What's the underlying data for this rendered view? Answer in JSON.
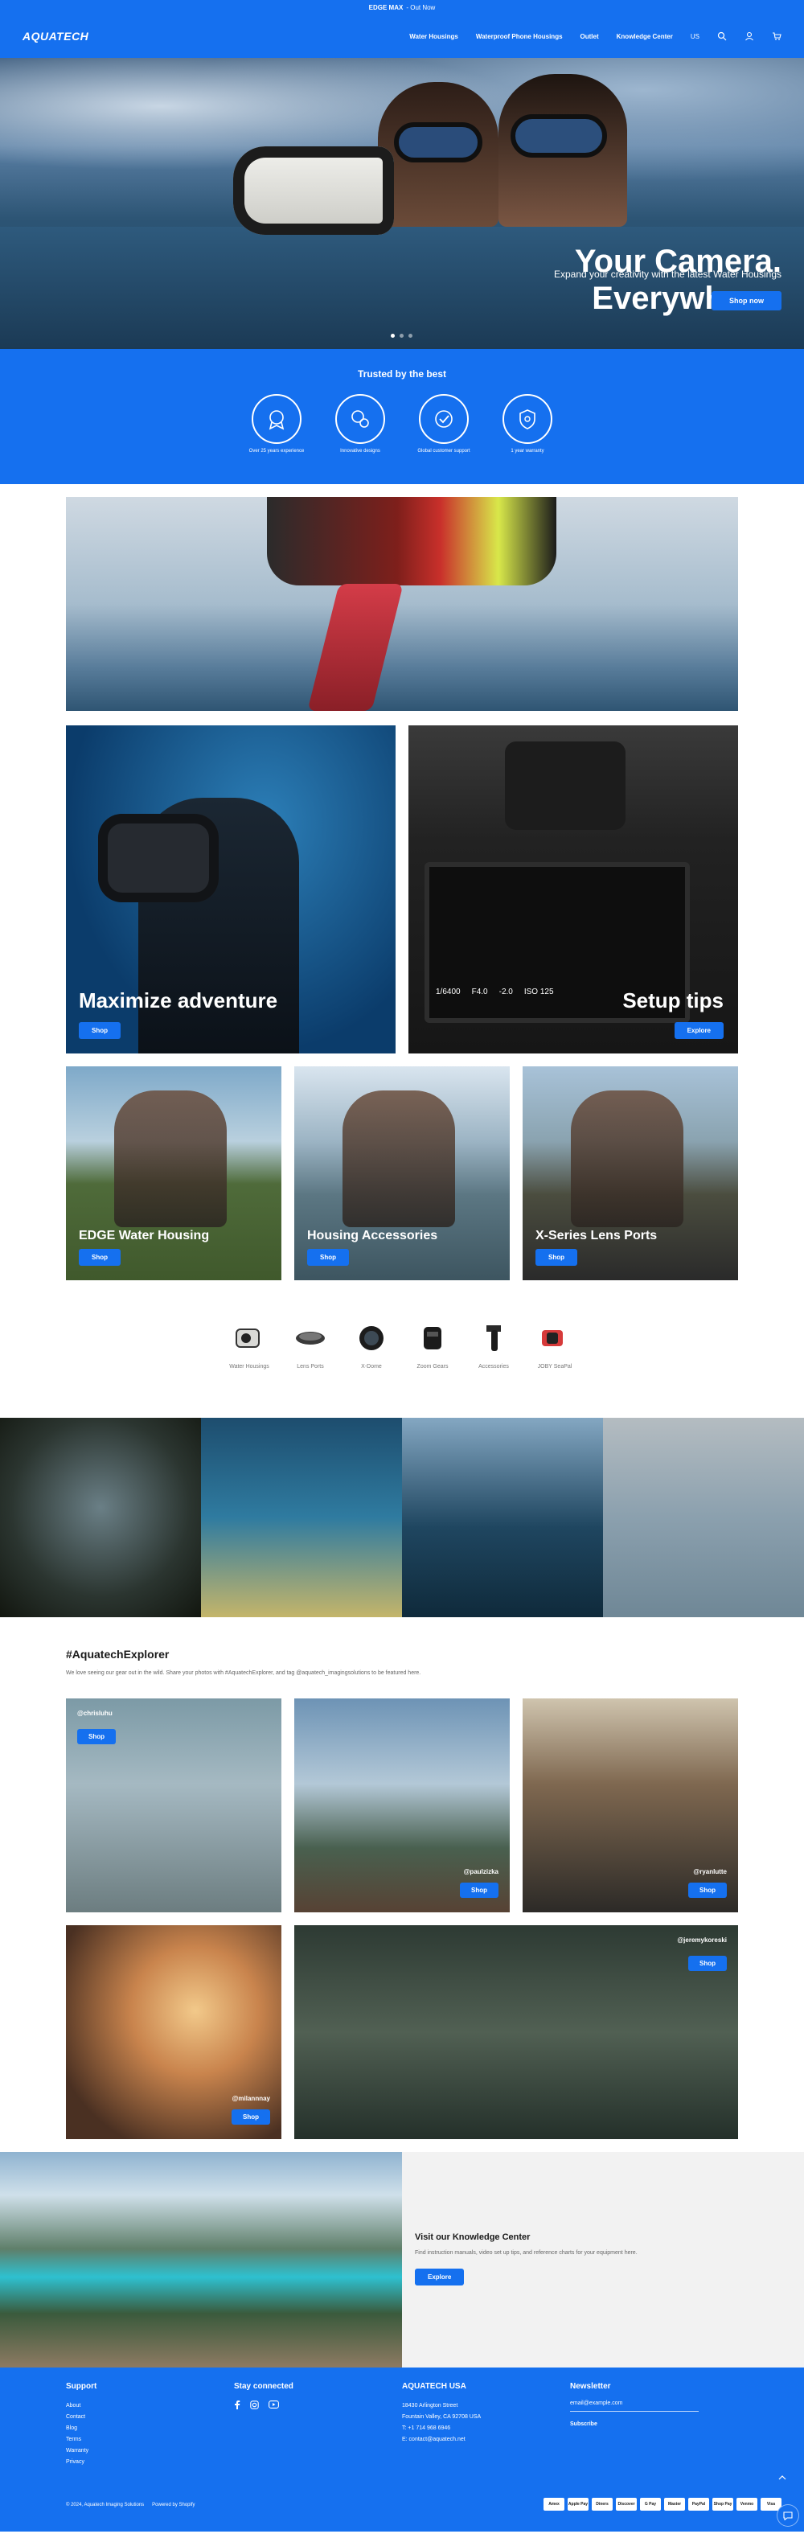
{
  "announcement": {
    "bold": "EDGE MAX",
    "text": "- Out Now"
  },
  "header": {
    "logo": "AQUATECH",
    "nav": [
      "Water Housings",
      "Waterproof Phone Housings",
      "Outlet",
      "Knowledge Center"
    ],
    "lang": "US"
  },
  "hero": {
    "title_line1": "Your Camera.",
    "title_line2": "Everywhere.",
    "subtitle": "Expand your creativity with the latest Water Housings",
    "button": "Shop now"
  },
  "trust": {
    "title": "Trusted by the best",
    "items": [
      {
        "label": "Over 25 years experience",
        "icon": "award-icon"
      },
      {
        "label": "Innovative designs",
        "icon": "design-icon"
      },
      {
        "label": "Global customer support",
        "icon": "globe-check-icon"
      },
      {
        "label": "1 year warranty",
        "icon": "shield-icon"
      }
    ]
  },
  "features": [
    {
      "title": "Maximize adventure",
      "button": "Shop"
    },
    {
      "title": "Setup tips",
      "button": "Explore"
    }
  ],
  "camera_hud": {
    "shutter": "1/6400",
    "aperture": "F4.0",
    "ev": "-2.0",
    "iso": "ISO 125"
  },
  "tri_cards": [
    {
      "title": "EDGE Water Housing",
      "button": "Shop"
    },
    {
      "title": "Housing Accessories",
      "button": "Shop"
    },
    {
      "title": "X-Series Lens Ports",
      "button": "Shop"
    }
  ],
  "categories": [
    {
      "name": "Water Housings",
      "icon": "housing-icon"
    },
    {
      "name": "Lens Ports",
      "icon": "lens-port-icon"
    },
    {
      "name": "X-Dome",
      "icon": "dome-icon"
    },
    {
      "name": "Zoom Gears",
      "icon": "zoom-gear-icon"
    },
    {
      "name": "Accessories",
      "icon": "grip-icon"
    },
    {
      "name": "JOBY SeaPal",
      "icon": "seapal-icon"
    }
  ],
  "explorer": {
    "title": "#AquatechExplorer",
    "text": "We love seeing our gear out in the wild. Share your photos with #AquatechExplorer, and tag @aquatech_imagingsolutions to be featured here.",
    "posts": [
      {
        "handle": "@chrisluhu",
        "button": "Shop"
      },
      {
        "handle": "@paulzizka",
        "button": "Shop"
      },
      {
        "handle": "@ryanlutte",
        "button": "Shop"
      },
      {
        "handle": "@milannnay",
        "button": "Shop"
      },
      {
        "handle": "@jeremykoreski",
        "button": "Shop"
      }
    ]
  },
  "knowledge": {
    "title": "Visit our Knowledge Center",
    "text": "Find instruction manuals, video set up tips, and reference charts for your equipment here.",
    "button": "Explore"
  },
  "footer": {
    "support_title": "Support",
    "support_links": [
      "About",
      "Contact",
      "Blog",
      "Terms",
      "Warranty",
      "Privacy"
    ],
    "social_title": "Stay connected",
    "usa_title": "AQUATECH USA",
    "address1": "18430 Arlington Street",
    "address2": "Fountain Valley, CA 92708 USA",
    "phone": "T: +1 714 968 6946",
    "email": "E: contact@aquatech.net",
    "newsletter_title": "Newsletter",
    "newsletter_placeholder": "email@example.com",
    "newsletter_button": "Subscribe",
    "copyright": "© 2024, Aquatech Imaging Solutions",
    "powered": "Powered by Shopify",
    "payments": [
      "Amex",
      "Apple Pay",
      "Diners",
      "Discover",
      "G Pay",
      "Master",
      "PayPal",
      "Shop Pay",
      "Venmo",
      "Visa"
    ]
  }
}
